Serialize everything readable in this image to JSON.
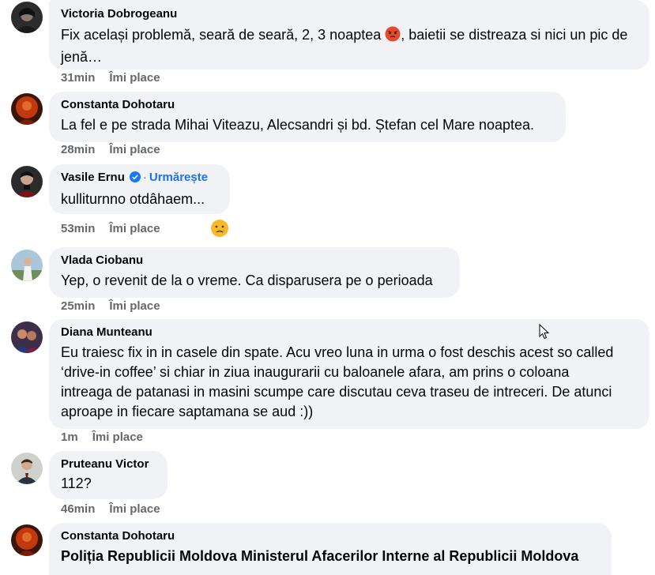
{
  "comments": [
    {
      "author": "Victoria Dobrogeanu",
      "text_before": "Fix același problemă, seară de seară, 2, 3 noaptea ",
      "text_after": ", baietii se distreaza si nici un pic de jenă…",
      "inline_emoji": "angry-face",
      "time": "31min",
      "like": "Îmi place",
      "avatar_color": "#2c2c2c"
    },
    {
      "author": "Constanta Dohotaru",
      "text": "La fel e pe strada Mihai Viteazu, Alecsandri și bd. Ștefan cel Mare noaptea.",
      "time": "28min",
      "like": "Îmi place",
      "avatar_color": "#c0390f"
    },
    {
      "author": "Vasile Ernu",
      "verified": true,
      "separator": "·",
      "follow": "Urmărește",
      "text": "kulliturnno otdâhaem...",
      "time": "53min",
      "like": "Îmi place",
      "reaction": "sad-face",
      "avatar_color": "#3a3a3a"
    },
    {
      "author": "Vlada Ciobanu",
      "text": "Yep, o revenit de la o vreme. Ca disparusera pe o perioada",
      "time": "25min",
      "like": "Îmi place",
      "avatar_color": "#8fb2c9"
    },
    {
      "author": "Diana Munteanu",
      "lines": [
        "Eu traiesc fix in in casele din spate. Acu vreo luna in urma o fost deschis acest so called",
        "‘drive-in coffee’ si chiar in ziua inaugurarii cu baloanele afara, am prins o coloana",
        "intreaga de patanasi in masini scumpe care discutau ceva traseu de intreceri. De atunci",
        "aproape in fiecare saptamana se aud :))"
      ],
      "time": "1m",
      "like": "Îmi place",
      "avatar_color": "#3d2f4a"
    },
    {
      "author": "Pruteanu Victor",
      "text": "112?",
      "time": "46min",
      "like": "Îmi place",
      "avatar_color": "#b9b9b0"
    },
    {
      "author": "Constanta Dohotaru",
      "text": "Poliția Republicii Moldova Ministerul Afacerilor Interne al Republicii Moldova",
      "avatar_color": "#c0390f"
    }
  ],
  "colors": {
    "bubble": "#f0f2f5",
    "meta": "#65676b",
    "follow": "#1a73e8",
    "verified": "#1877f2"
  }
}
